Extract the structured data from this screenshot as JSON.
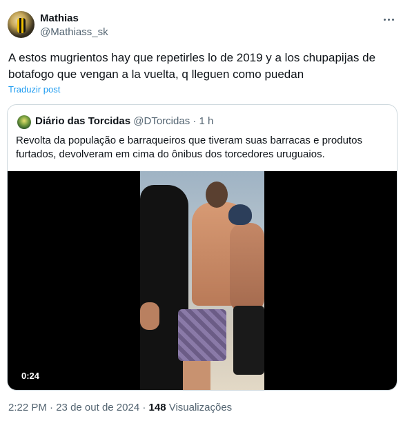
{
  "author": {
    "name": "Mathias",
    "handle": "@Mathiass_sk"
  },
  "tweet": {
    "text": "A estos mugrientos hay que repetirles lo de 2019 y a los chupapijas de botafogo que vengan a la vuelta, q lleguen como puedan",
    "translate_label": "Traduzir post"
  },
  "quote": {
    "name": "Diário das Torcidas",
    "handle": "@DTorcidas",
    "separator": "·",
    "time": "1 h",
    "text": "Revolta da população e barraqueiros que tiveram suas barracas e produtos furtados, devolveram em cima do ônibus dos torcedores uruguaios.",
    "video_duration": "0:24"
  },
  "meta": {
    "time": "2:22 PM",
    "separator1": "·",
    "date": "23 de out de 2024",
    "separator2": "·",
    "views_count": "148",
    "views_label": "Visualizações"
  },
  "icons": {
    "more": "more-horizontal-icon"
  }
}
